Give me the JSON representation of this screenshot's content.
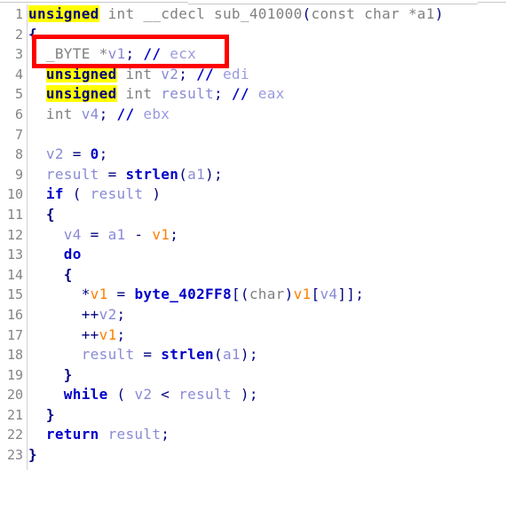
{
  "window": {
    "app": "IDA Pro — Hex-Rays Decompiler",
    "view": "Pseudocode",
    "background_color": "#ffffff"
  },
  "editor": {
    "gutter": {
      "line_numbers": [
        "1",
        "2",
        "3",
        "4",
        "5",
        "6",
        "7",
        "8",
        "9",
        "10",
        "11",
        "12",
        "13",
        "14",
        "15",
        "16",
        "17",
        "18",
        "19",
        "20",
        "21",
        "22",
        "23"
      ],
      "color": "#848484",
      "separator_color": "#d0d0d0"
    },
    "search_highlight": {
      "term": "unsigned",
      "color": "#ffff00",
      "match_lines": [
        1,
        4,
        5
      ]
    },
    "highlighted_variable": {
      "name": "v1",
      "color": "#ff8000"
    },
    "function_name": "sub_401000",
    "lines": [
      {
        "n": "1",
        "text": "unsigned int __cdecl sub_401000(const char *a1)"
      },
      {
        "n": "2",
        "text": "{"
      },
      {
        "n": "3",
        "text": "  _BYTE *v1; // ecx"
      },
      {
        "n": "4",
        "text": "  unsigned int v2; // edi"
      },
      {
        "n": "5",
        "text": "  unsigned int result; // eax"
      },
      {
        "n": "6",
        "text": "  int v4; // ebx"
      },
      {
        "n": "7",
        "text": ""
      },
      {
        "n": "8",
        "text": "  v2 = 0;"
      },
      {
        "n": "9",
        "text": "  result = strlen(a1);"
      },
      {
        "n": "10",
        "text": "  if ( result )"
      },
      {
        "n": "11",
        "text": "  {"
      },
      {
        "n": "12",
        "text": "    v4 = a1 - v1;"
      },
      {
        "n": "13",
        "text": "    do"
      },
      {
        "n": "14",
        "text": "    {"
      },
      {
        "n": "15",
        "text": "      *v1 = byte_402FF8[(char)v1[v4]];"
      },
      {
        "n": "16",
        "text": "      ++v2;"
      },
      {
        "n": "17",
        "text": "      ++v1;"
      },
      {
        "n": "18",
        "text": "      result = strlen(a1);"
      },
      {
        "n": "19",
        "text": "    }"
      },
      {
        "n": "20",
        "text": "    while ( v2 < result );"
      },
      {
        "n": "21",
        "text": "  }"
      },
      {
        "n": "22",
        "text": "  return result;"
      },
      {
        "n": "23",
        "text": "}"
      }
    ],
    "tokens": {
      "line1": [
        "unsigned",
        "int",
        "__cdecl",
        "sub_401000",
        "(",
        "const",
        "char",
        "*a1",
        ")"
      ],
      "line3": [
        "_BYTE",
        "*",
        "v1",
        ";",
        "//",
        "ecx"
      ],
      "line4": [
        "unsigned",
        "int",
        "v2",
        ";",
        "//",
        "edi"
      ],
      "line5": [
        "unsigned",
        "int",
        "result",
        ";",
        "//",
        "eax"
      ],
      "line6": [
        "int",
        "v4",
        ";",
        "//",
        "ebx"
      ],
      "line8": [
        "v2",
        "=",
        "0",
        ";"
      ],
      "line9": [
        "result",
        "=",
        "strlen",
        "(",
        "a1",
        ")",
        ";"
      ],
      "line10": [
        "if",
        "(",
        "result",
        ")"
      ],
      "line12": [
        "v4",
        "=",
        "a1",
        "-",
        "v1",
        ";"
      ],
      "line13": [
        "do"
      ],
      "line15": [
        "*",
        "v1",
        "=",
        "byte_402FF8",
        "[",
        "(",
        "char",
        ")",
        "v1",
        "[",
        "v4",
        "]",
        "]",
        ";"
      ],
      "line16": [
        "++",
        "v2",
        ";"
      ],
      "line17": [
        "++",
        "v1",
        ";"
      ],
      "line18": [
        "result",
        "=",
        "strlen",
        "(",
        "a1",
        ")",
        ";"
      ],
      "line20": [
        "while",
        "(",
        "v2",
        "<",
        "result",
        ")",
        ";"
      ],
      "line22": [
        "return",
        "result",
        ";"
      ]
    },
    "registers": [
      "ecx",
      "edi",
      "eax",
      "ebx"
    ],
    "data_symbol": "byte_402FF8",
    "called_function": "strlen"
  },
  "annotation": {
    "type": "rectangle",
    "color": "#ff0000",
    "border_width": 5,
    "target_line": "3",
    "target_text": "_BYTE *v1; // ecx"
  },
  "palette": {
    "type_grey": "#808080",
    "punctuation_navy": "#000080",
    "keyword_blue": "#0000c8",
    "variable_lavender": "#8a8ad6",
    "highlight_orange": "#ff8000",
    "comment_lavender": "#9a9ae0",
    "match_yellow": "#ffff00",
    "annotation_red": "#ff0000"
  }
}
